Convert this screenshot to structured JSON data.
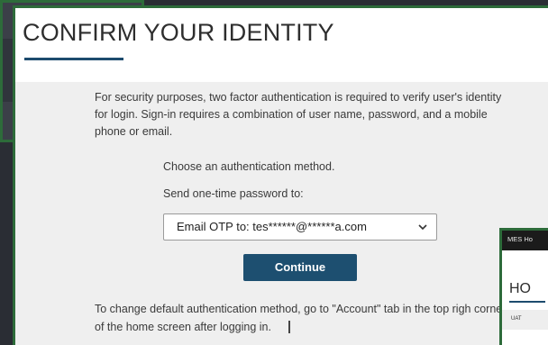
{
  "page": {
    "title": "CONFIRM YOUR IDENTITY",
    "intro": "For security purposes, two factor authentication is required to verify user's identity for login. Sign-in requires a combination of user name, password, and a mobile phone or email.",
    "choose_label": "Choose an authentication method.",
    "send_label": "Send one-time password to:",
    "method_select": {
      "selected": "Email OTP to: tes******@******a.com"
    },
    "continue_label": "Continue",
    "footer_note": "To change default authentication method, go to \"Account\" tab in the top righ corner of the home screen after logging in."
  },
  "mini_window": {
    "topbar_text": "MES Ho",
    "heading": "HO",
    "strip_text": "UAT"
  },
  "colors": {
    "frame": "#2d6b3a",
    "accent": "#1d4f70",
    "panel_bg": "#efefef"
  }
}
